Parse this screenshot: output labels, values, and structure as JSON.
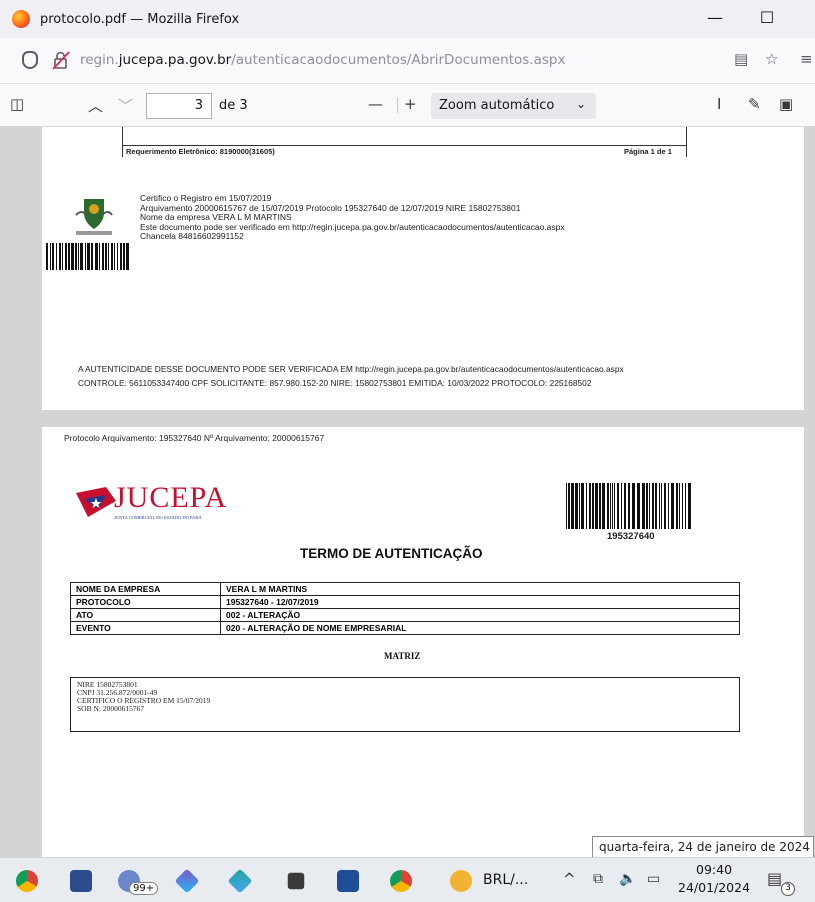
{
  "window": {
    "title": "protocolo.pdf — Mozilla Firefox"
  },
  "url": {
    "host_prefix": "regin.",
    "host_main": "jucepa.pa.gov.br",
    "path": "/autenticacaodocumentos/AbrirDocumentos.aspx"
  },
  "pdf_toolbar": {
    "page_number": "3",
    "of_pages": "de 3",
    "zoom": "Zoom automático"
  },
  "page_prev": {
    "requerimento": "Requerimento Eletrônico: 8190000(31605)",
    "pagina": "Página 1 de 1",
    "cert_lines": [
      "Certifico o Registro em 15/07/2019",
      "Arquivamento 20000615767 de 15/07/2019 Protocolo 195327640 de 12/07/2019 NIRE 15802753801",
      "Nome da empresa VERA L M MARTINS",
      "Este documento pode ser verificado em http://regin.jucepa.pa.gov.br/autenticacaodocumentos/autenticacao.aspx",
      "Chancela 84816602991152"
    ],
    "authenticity": "A AUTENTICIDADE DESSE DOCUMENTO PODE SER VERIFICADA EM http://regin.jucepa.pa.gov.br/autenticacaodocumentos/autenticacao.aspx",
    "controle": "CONTROLE: 5611053347400 CPF SOLICITANTE: 857.980.152-20 NIRE: 15802753801 EMITIDA: 10/03/2022 PROTOCOLO: 225168502"
  },
  "page_current": {
    "header": "Protocolo Arquivamento: 195327640 Nº Arquivamento: 20000615767",
    "logo_text": "JUCEPA",
    "logo_subtext": "JUNTA COMERCIAL DO ESTADO DO PARÁ",
    "barcode_number": "195327640",
    "heading": "TERMO DE AUTENTICAÇÃO",
    "rows": [
      {
        "label": "NOME DA EMPRESA",
        "value": "VERA L M MARTINS"
      },
      {
        "label": "PROTOCOLO",
        "value": "195327640 - 12/07/2019"
      },
      {
        "label": "ATO",
        "value": "002 - ALTERAÇÃO"
      },
      {
        "label": "EVENTO",
        "value": "020 - ALTERAÇÃO DE NOME EMPRESARIAL"
      }
    ],
    "matriz": "MATRIZ",
    "matriz_lines": [
      "NIRE 15802753801",
      "CNPJ 31.256.872/0001-49",
      "CERTIFICO O REGISTRO EM 15/07/2019",
      "SOB N: 20000615767"
    ]
  },
  "tooltip": "quarta-feira, 24 de janeiro de 2024",
  "taskbar": {
    "badge": "99+",
    "app_label": "BRL/...",
    "time": "09:40",
    "date": "24/01/2024",
    "notif_count": "3"
  },
  "colors": {
    "jucepa_red": "#c8102e",
    "jucepa_blue": "#1f3a93",
    "taskbar": "#e8ecf1"
  }
}
